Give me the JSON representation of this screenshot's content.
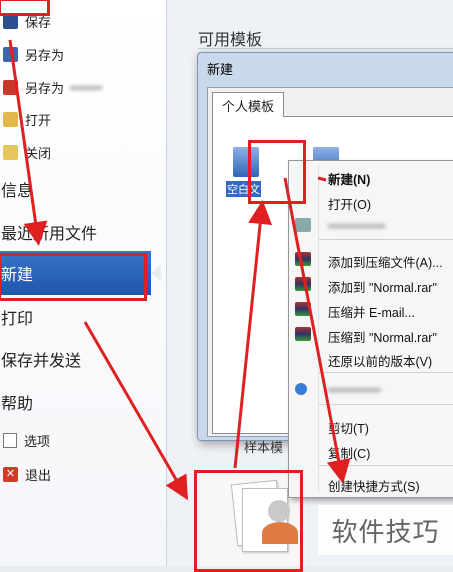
{
  "sidebar": {
    "small_items": [
      {
        "label": "保存",
        "icon": "save-icon"
      },
      {
        "label": "另存为",
        "icon": "save-as-icon"
      },
      {
        "label": "另存为",
        "icon": "save-as-adobe-icon"
      },
      {
        "label": "打开",
        "icon": "open-folder-icon"
      },
      {
        "label": "关闭",
        "icon": "close-folder-icon"
      }
    ],
    "info": "信息",
    "recent": "最近所用文件",
    "new": "新建",
    "print": "打印",
    "save_send": "保存并发送",
    "help": "帮助",
    "options": "选项",
    "exit": "退出"
  },
  "main": {
    "available_templates": "可用模板",
    "bottom_label": "样本模"
  },
  "dialog": {
    "title": "新建",
    "tab": "个人模板",
    "blank_label": "空白文"
  },
  "context_menu": {
    "items": [
      {
        "label": "新建(N)",
        "bold": true
      },
      {
        "label": "打开(O)"
      },
      {
        "label": "添加到压缩文件(A)..."
      },
      {
        "label": "添加到 \"Normal.rar\""
      },
      {
        "label": "压缩并 E-mail..."
      },
      {
        "label": "压缩到 \"Normal.rar\""
      },
      {
        "label": "还原以前的版本(V)"
      },
      {
        "label": "剪切(T)"
      },
      {
        "label": "复制(C)"
      },
      {
        "label": "创建快捷方式(S)"
      }
    ]
  },
  "watermark": "软件技巧",
  "colors": {
    "accent_blue": "#2a62b9",
    "annotation_red": "#e02020"
  }
}
